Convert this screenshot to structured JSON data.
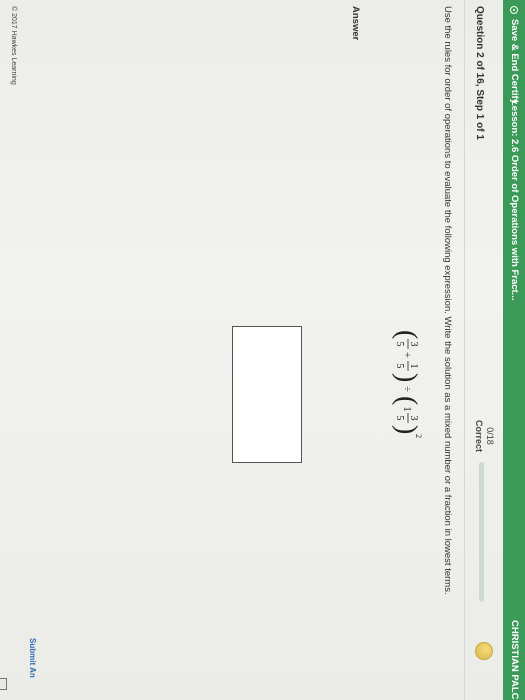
{
  "topbar": {
    "save_label": "Save & End Certify",
    "lesson_title": "Lesson: 2.6 Order of Operations with Fract...",
    "user_name": "CHRISTIAN PALC"
  },
  "question": {
    "header": "Question 2 of 16, Step 1 of 1",
    "score": "0/18",
    "score_label": "Correct",
    "progress": 0,
    "instructions": "Use the rules for order of operations to evaluate the following expression. Write the solution as a mixed number or a fraction in lowest terms.",
    "expression": {
      "frac1_num": "3",
      "frac1_den": "5",
      "plus": "+",
      "frac2_num": "1",
      "frac2_den": "5",
      "divide": "÷",
      "mixed_whole": "1",
      "mixed_num": "3",
      "mixed_den": "5",
      "exponent": "2"
    },
    "answer_label": "Answer"
  },
  "footer": {
    "copyright": "© 2017 Hawkes Learning",
    "submit_label": "Submit An"
  },
  "colors": {
    "topbar": "#3b9a57",
    "link": "#2f6db5"
  }
}
